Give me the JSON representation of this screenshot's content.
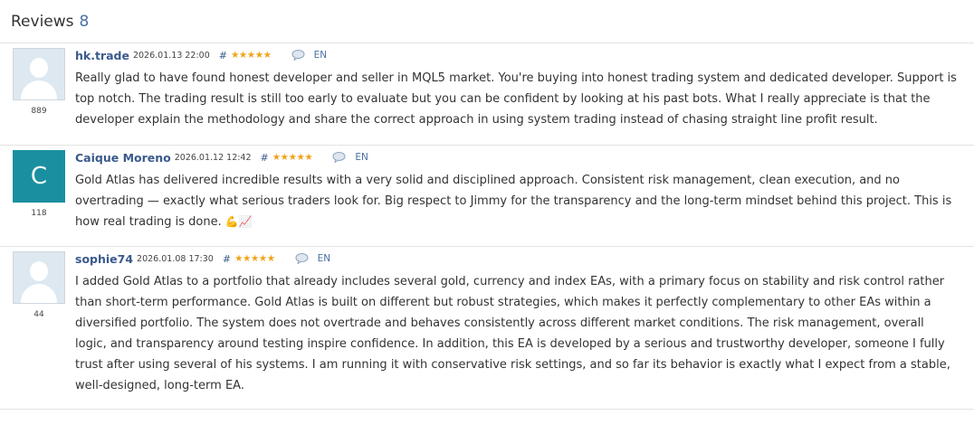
{
  "header": {
    "title": "Reviews",
    "count": "8"
  },
  "reviews": [
    {
      "author": "hk.trade",
      "date": "2026.01.13 22:00",
      "hash": "#",
      "stars": "★★★★★",
      "lang": "EN",
      "rating": "889",
      "avatar": "default",
      "text": "Really glad to have found honest developer and seller in MQL5 market. You're buying into honest trading system and dedicated developer. Support is top notch. The trading result is still too early to evaluate but you can be confident by looking at his past bots. What I really appreciate is that the developer explain the methodology and share the correct approach in using system trading instead of chasing straight line profit result."
    },
    {
      "author": "Caique Moreno",
      "date": "2026.01.12 12:42",
      "hash": "#",
      "stars": "★★★★★",
      "lang": "EN",
      "rating": "118",
      "avatar": "letter",
      "avatar_letter": "C",
      "text": "Gold Atlas has delivered incredible results with a very solid and disciplined approach. Consistent risk management, clean execution, and no overtrading — exactly what serious traders look for. Big respect to Jimmy for the transparency and the long-term mindset behind this project. This is how real trading is done.",
      "emojis": "💪📈"
    },
    {
      "author": "sophie74",
      "date": "2026.01.08 17:30",
      "hash": "#",
      "stars": "★★★★★",
      "lang": "EN",
      "rating": "44",
      "avatar": "default",
      "text": "I added Gold Atlas to a portfolio that already includes several gold, currency and index EAs, with a primary focus on stability and risk control rather than short-term performance. Gold Atlas is built on different but robust strategies, which makes it perfectly complementary to other EAs within a diversified portfolio. The system does not overtrade and behaves consistently across different market conditions. The risk management, overall logic, and transparency around testing inspire confidence. In addition, this EA is developed by a serious and trustworthy developer, someone I fully trust after using several of his systems. I am running it with conservative risk settings, and so far its behavior is exactly what I expect from a stable, well-designed, long-term EA."
    }
  ]
}
